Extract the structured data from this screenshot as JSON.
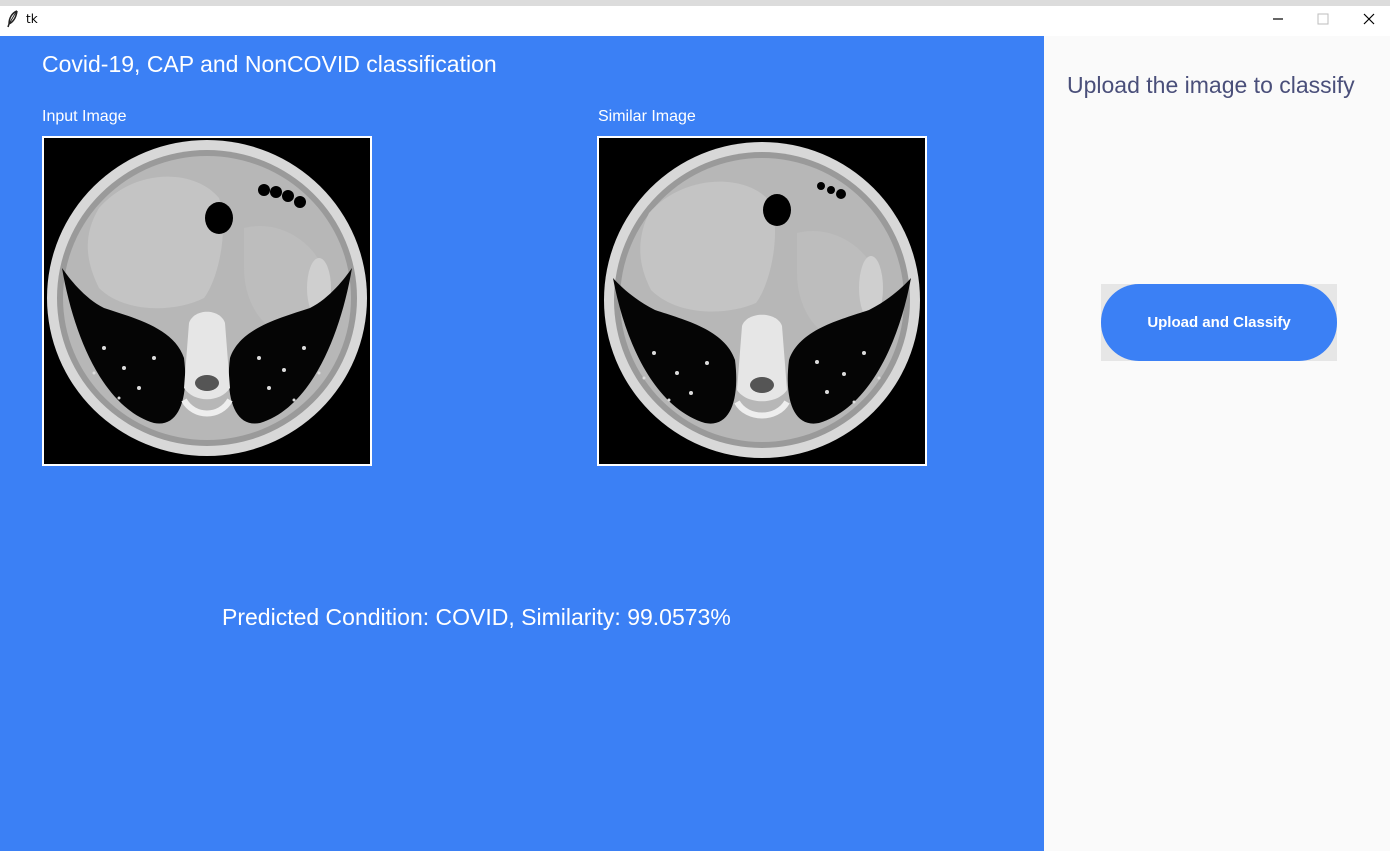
{
  "window": {
    "title": "tk"
  },
  "main": {
    "title": "Covid-19, CAP and NonCOVID classification",
    "input_label": "Input Image",
    "similar_label": "Similar Image",
    "prediction": "Predicted Condition: COVID, Similarity: 99.0573%"
  },
  "sidebar": {
    "heading": "Upload the image to classify",
    "button_label": "Upload and Classify"
  },
  "colors": {
    "primary_blue": "#3b80f5",
    "sidebar_bg": "#fafafa",
    "heading_text": "#4a4f7a"
  },
  "icons": {
    "app": "feather-icon",
    "minimize": "minimize-icon",
    "maximize": "maximize-icon",
    "close": "close-icon"
  }
}
